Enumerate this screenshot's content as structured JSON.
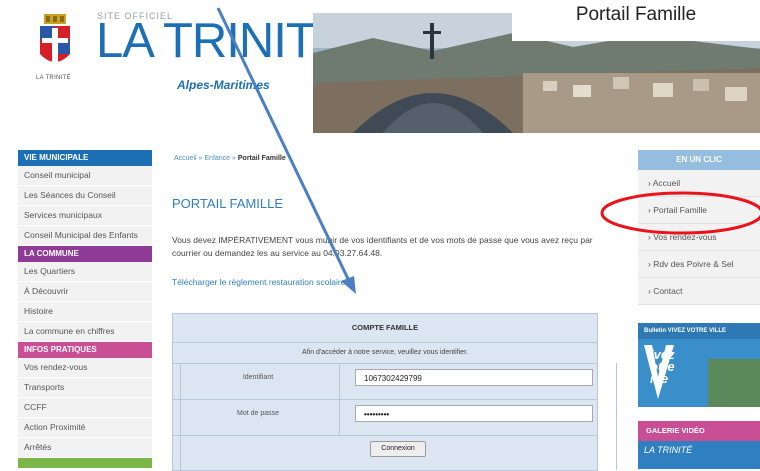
{
  "header": {
    "crest_caption": "LA TRINITÉ",
    "site_officiel": "SITE OFFICIEL",
    "site_name": "LA TRINITÉ",
    "site_subtitle": "Alpes-Maritimes",
    "overlay_label": "Portail Famille"
  },
  "left_sidebar": {
    "sections": [
      {
        "title": "VIE MUNICIPALE",
        "color": "#1d6fb5",
        "items": [
          "Conseil municipal",
          "Les Séances du Conseil",
          "Services municipaux",
          "Conseil Municipal des Enfants"
        ]
      },
      {
        "title": "LA COMMUNE",
        "color": "#8e3a97",
        "items": [
          "Les Quartiers",
          "À Découvrir",
          "Histoire",
          "La commune en chiffres"
        ]
      },
      {
        "title": "INFOS PRATIQUES",
        "color": "#c84f95",
        "items": [
          "Vos rendez-vous",
          "Transports",
          "CCFF",
          "Action Proximité",
          "Arrêtés"
        ]
      }
    ]
  },
  "main": {
    "breadcrumb": {
      "home": "Accueil",
      "sep": "»",
      "section": "Enfance",
      "current": "Portail Famille"
    },
    "title": "PORTAIL FAMILLE",
    "intro": "Vous devez IMPÉRATIVEMENT vous munir de vos identifiants et de vos mots de passe que vous avez reçu par courrier ou demandez les au service au 04.93.27.64.48.",
    "download_link": "Télécharger le règlement restauration scolaire",
    "form": {
      "title": "COMPTE FAMILLE",
      "message": "Afin d'accéder à notre service, veuillez vous identifier.",
      "identifiant_label": "Identifiant",
      "identifiant_value": "1067302429799",
      "password_label": "Mot de passe",
      "password_value": "•••••••••",
      "submit_label": "Connexion"
    }
  },
  "right_sidebar": {
    "title": "EN UN CLIC",
    "items": [
      "› Accueil",
      "› Portail Famille",
      "› Vos rendez-vous",
      "› Rdv des Poivre & Sel",
      "› Contact"
    ],
    "ad_band": "Bulletin VIVEZ VOTRE VILLE",
    "ad_lines": [
      "ivez",
      "otre",
      "ille"
    ],
    "video_band": "GALERIE VIDÉO",
    "video_sub": "LA TRINITÉ"
  },
  "annotations": {
    "arrow_color": "#4a7fc1",
    "circle_color": "#e8131b"
  }
}
